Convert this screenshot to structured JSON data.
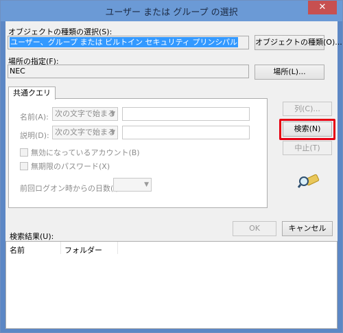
{
  "window": {
    "title": "ユーザー または グループ の選択",
    "close_glyph": "✕"
  },
  "object_type": {
    "label": "オブジェクトの種類の選択(S):",
    "value": "ユーザー、グループ または ビルトイン セキュリティ プリンシパル",
    "button": "オブジェクトの種類(O)..."
  },
  "location": {
    "label": "場所の指定(F):",
    "value": "NEC",
    "button": "場所(L)..."
  },
  "query_tab": {
    "tab_label": "共通クエリ",
    "name_label": "名前(A):",
    "name_mode": "次の文字で始まる",
    "desc_label": "説明(D):",
    "desc_mode": "次の文字で始まる",
    "disabled_accounts": "無効になっているアカウント(B)",
    "no_expire_password": "無期限のパスワード(X)",
    "days_since_logon_label": "前回ログオン時からの日数(I):"
  },
  "side_buttons": {
    "columns": "列(C)...",
    "search": "検索(N)",
    "stop": "中止(T)"
  },
  "footer": {
    "ok": "OK",
    "cancel": "キャンセル"
  },
  "results": {
    "label": "検索結果(U):",
    "columns": [
      "名前",
      "フォルダー"
    ]
  },
  "colors": {
    "highlight": "#e60012",
    "selection": "#3399ff",
    "titlebar": "#6b9ad6"
  },
  "icons": {
    "search_magnifier": "magnifier-icon"
  }
}
